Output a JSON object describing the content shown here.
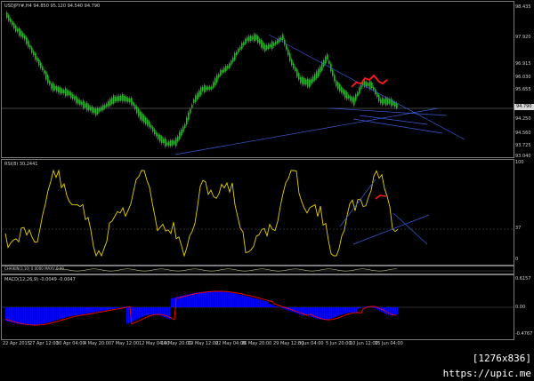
{
  "main": {
    "title": "USDJPY#,H4  94.850 95.120 94.540 94.790",
    "price_labels": [
      "98.435",
      "97.920",
      "96.915",
      "96.030",
      "95.655",
      "95.020",
      "94.250",
      "94.560",
      "93.725",
      "93.040"
    ],
    "current_price": "94.790"
  },
  "rsi": {
    "title": "RSI(8) 30.2441",
    "levels": [
      "100",
      "37",
      "0"
    ]
  },
  "osc": {
    "title": "CHAIKIN(3,10)  0.0000  MAXV  0.00"
  },
  "macd": {
    "title": "MACD(12,26,9) -0.0049 -0.0047",
    "levels": [
      "0.6157",
      "0.00",
      "-0.4767"
    ]
  },
  "time_labels": [
    "22 Apr 2015",
    "27 Apr 12:00",
    "30 Apr 04:00",
    "4 May 20:00",
    "7 May 12:00",
    "12 May 04:00",
    "14 May 20:00",
    "19 May 12:00",
    "22 May 04:00",
    "26 May 20:00",
    "29 May 12:00",
    "3 Jun 04:00",
    "5 Jun 20:00",
    "10 Jun 12:00",
    "15 Jun 04:00"
  ],
  "watermark": "[1276x836] https://upic.me",
  "colors": {
    "candles": "#00d000",
    "trendlines": "#3c5ad8",
    "rsi_line": "#e6d200",
    "macd_hist": "#0000ff",
    "macd_signal": "#ff0000",
    "annotation": "#ff1a1a"
  }
}
